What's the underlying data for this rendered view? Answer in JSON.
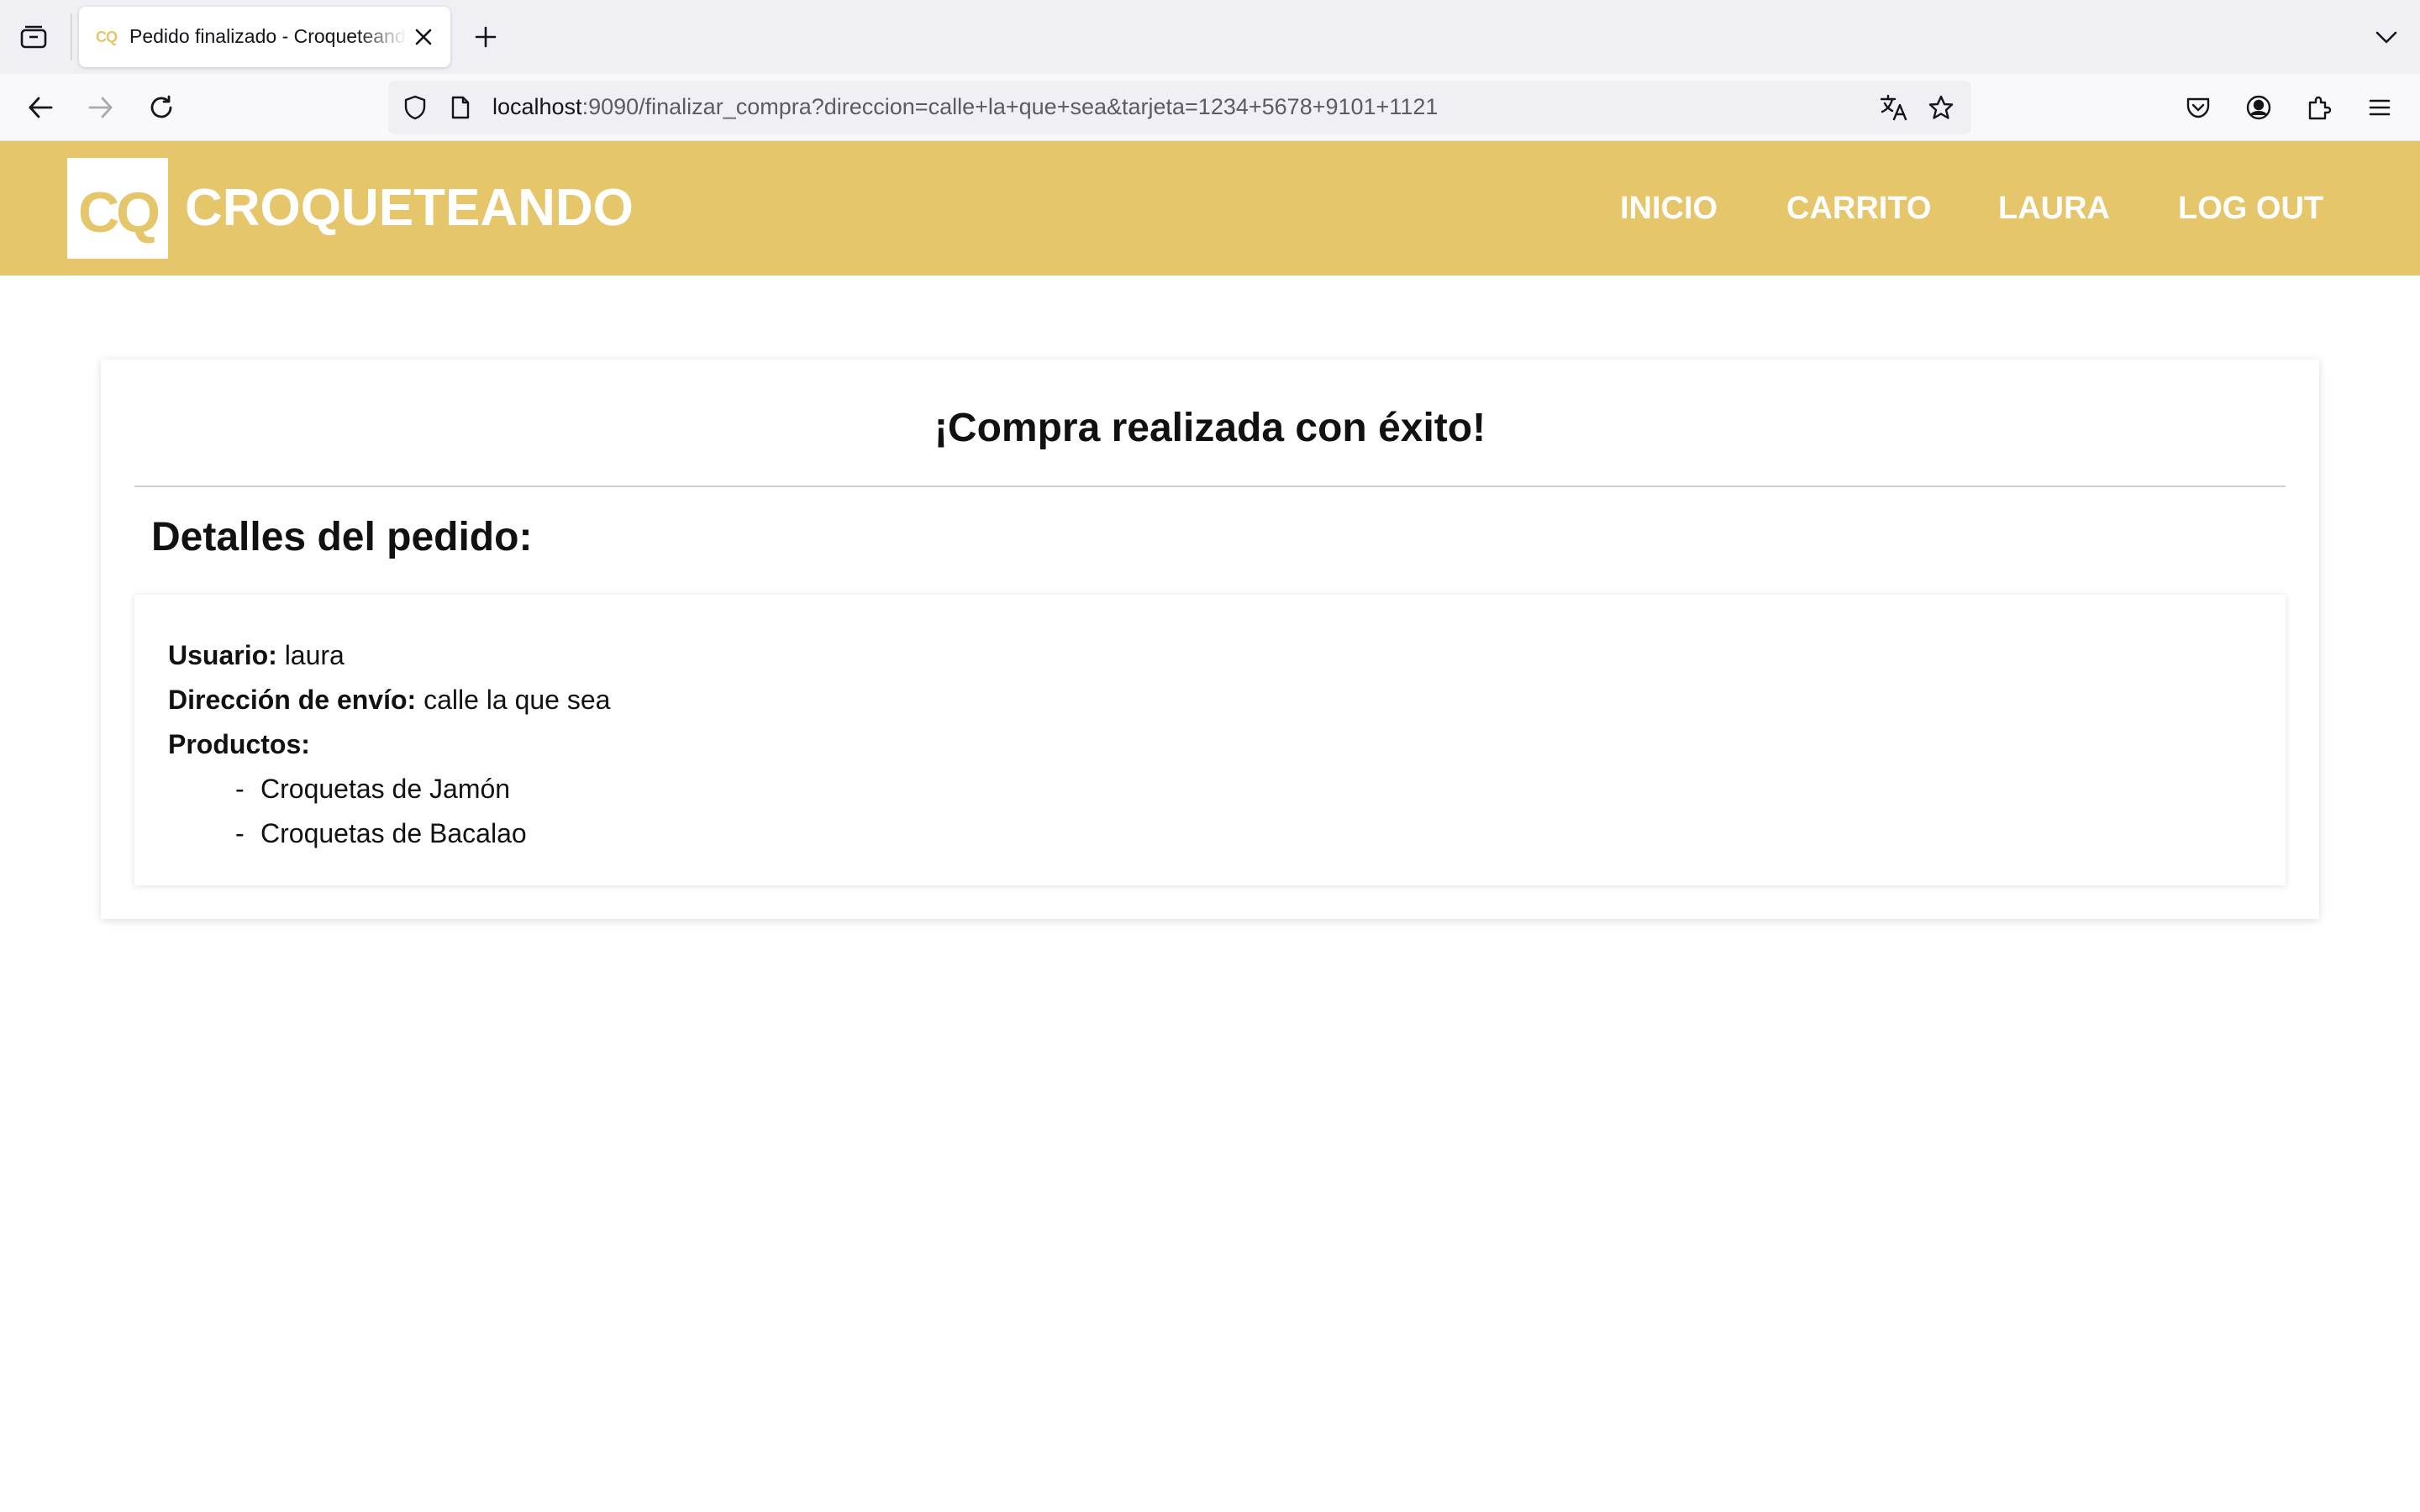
{
  "browser": {
    "tab_title": "Pedido finalizado - Croqueteando",
    "tab_favicon_text": "CQ",
    "url_host": "localhost",
    "url_rest": ":9090/finalizar_compra?direccion=calle+la+que+sea&tarjeta=1234+5678+9101+1121",
    "icons": [
      "tab-overview-icon",
      "close-icon",
      "plus-icon",
      "chevron-down-icon",
      "back-arrow-icon",
      "forward-arrow-icon",
      "reload-icon",
      "shield-icon",
      "page-icon",
      "translate-icon",
      "star-icon",
      "pocket-icon",
      "account-icon",
      "extensions-icon",
      "menu-icon"
    ]
  },
  "site": {
    "logo_text": "CQ",
    "name": "CROQUETEANDO",
    "brand_color": "#e6c66a",
    "nav": {
      "inicio": "INICIO",
      "carrito": "CARRITO",
      "user": "LAURA",
      "logout": "LOG OUT"
    }
  },
  "order": {
    "title": "¡Compra realizada con éxito!",
    "details_heading": "Detalles del pedido:",
    "user_label": "Usuario:",
    "user_value": "laura",
    "address_label": "Dirección de envío:",
    "address_value": "calle la que sea",
    "products_label": "Productos:",
    "products": [
      "Croquetas de Jamón",
      "Croquetas de Bacalao"
    ]
  }
}
